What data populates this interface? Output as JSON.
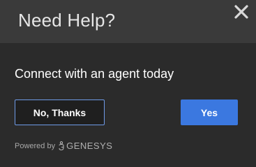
{
  "header": {
    "title": "Need Help?"
  },
  "body": {
    "message": "Connect with an agent today"
  },
  "actions": {
    "decline_label": "No, Thanks",
    "accept_label": "Yes"
  },
  "footer": {
    "powered_by": "Powered by",
    "brand": "GENESYS",
    "logo_icon": "genesys-logo-icon"
  },
  "colors": {
    "background": "#2b2b2b",
    "header_background": "#3a3a3a",
    "accent": "#3b78e0",
    "decline_border": "#6f9be8"
  }
}
